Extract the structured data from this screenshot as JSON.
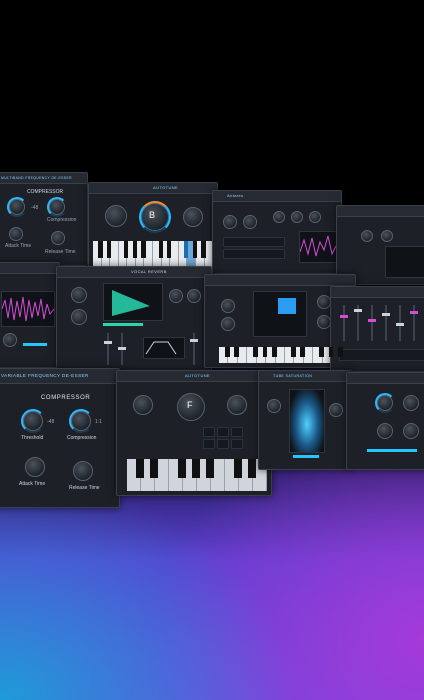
{
  "colors": {
    "accent": "#28b9ff",
    "magenta": "#d64bd8",
    "teal": "#28d7b0",
    "bg_blue": "#1e9bd8",
    "bg_purple": "#a53ad8"
  },
  "panels": {
    "compressor_small": {
      "title": "MULTIBAND FREQUENCY DE-ESSER",
      "section": "COMPRESSOR",
      "compression_label": "Compression",
      "attack_label": "Attack Time",
      "release_label": "Release Time",
      "threshold_value": "-48",
      "ratio_value": "1:1"
    },
    "autotune_top": {
      "title": "AUTOTUNE",
      "note": "B"
    },
    "synth_top": {
      "title": "Antares"
    },
    "vocal_reverb": {
      "title": "VOCAL REVERB"
    },
    "autotune_bottom": {
      "title": "AUTOTUNE",
      "note": "F"
    },
    "tube": {
      "title": "TUBE SATURATION"
    },
    "compressor_large": {
      "title": "VARIABLE FREQUENCY DE-ESSER",
      "section": "COMPRESSOR",
      "threshold_label": "Threshold",
      "compression_label": "Compression",
      "attack_label": "Attack Time",
      "release_label": "Release Time",
      "threshold_value": "-48",
      "ratio_value": "1:1"
    }
  }
}
